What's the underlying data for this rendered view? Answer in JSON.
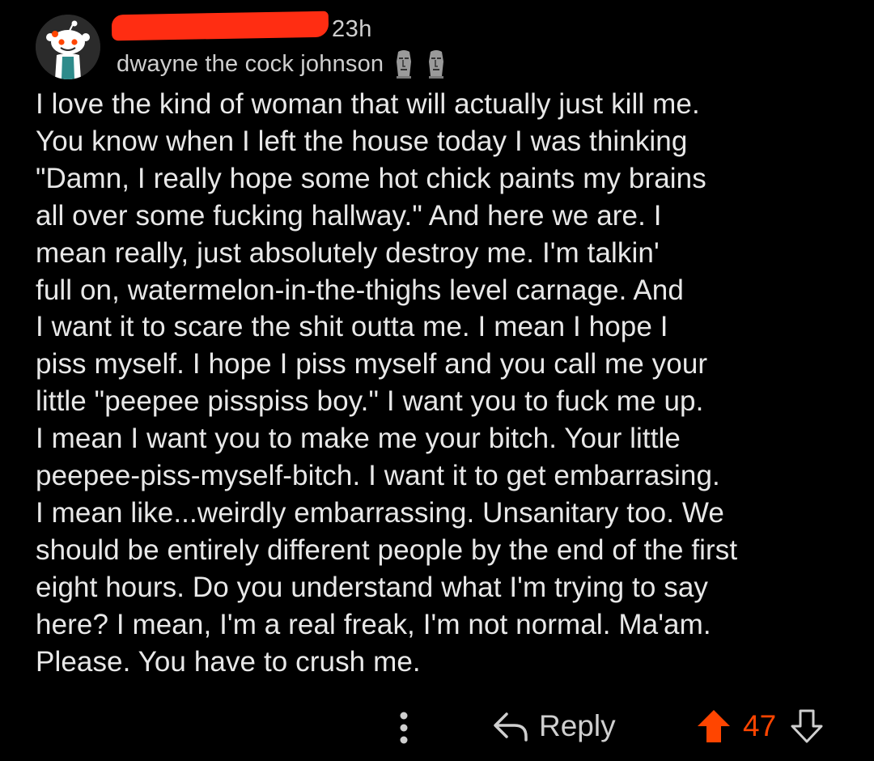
{
  "comment": {
    "timestamp": "23h",
    "flair": {
      "text": "dwayne the cock johnson",
      "emojis": [
        "moai-icon",
        "moai-icon"
      ]
    },
    "body": "I love the kind of woman that will actually just kill me.\nYou know when I left the house today I was thinking\n\"Damn, I really hope some hot chick paints my brains\nall over some fucking hallway.\" And here we are. I\nmean really, just absolutely destroy me. I'm talkin'\nfull on, watermelon-in-the-thighs level carnage. And\nI want it to scare the shit outta me. I mean I hope I\npiss myself. I hope I piss myself and you call me your\nlittle \"peepee pisspiss boy.\" I want you to fuck me up.\nI mean I want you to make me your bitch. Your little\npeepee-piss-myself-bitch. I want it to get embarrasing.\nI mean like...weirdly embarrassing. Unsanitary too. We\nshould be entirely different people by the end of the first\neight hours. Do you understand what I'm trying to say\nhere? I mean, I'm a real freak, I'm not normal. Ma'am.\nPlease. You have to crush me."
  },
  "actions": {
    "more_icon": "vertical-ellipsis-icon",
    "reply_label": "Reply",
    "score": "47"
  },
  "colors": {
    "background": "#000000",
    "text": "#e8e8e8",
    "muted": "#cfcfcf",
    "redaction": "#ff2d12",
    "upvote": "#ff4500"
  }
}
